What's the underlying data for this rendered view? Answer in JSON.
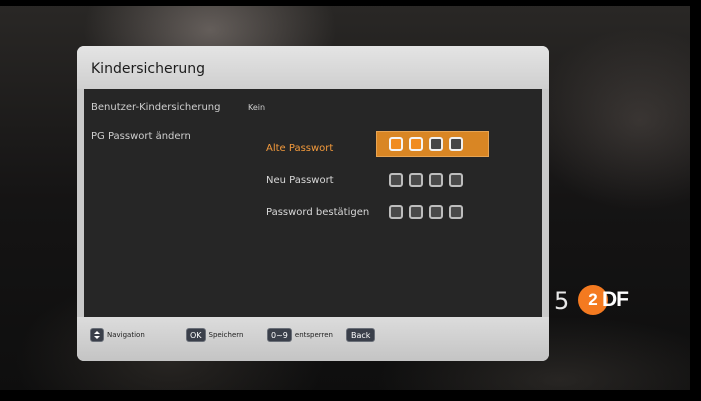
{
  "dialog": {
    "title": "Kindersicherung",
    "settings": [
      {
        "label": "Benutzer-Kindersicherung",
        "value": "Kein"
      },
      {
        "label": "PG Passwort ändern",
        "value": ""
      }
    ],
    "password_fields": [
      {
        "label": "Alte Passwort",
        "filled": 2,
        "total": 4,
        "active": true
      },
      {
        "label": "Neu Passwort",
        "filled": 0,
        "total": 4,
        "active": false
      },
      {
        "label": "Password bestätigen",
        "filled": 0,
        "total": 4,
        "active": false
      }
    ]
  },
  "footer": {
    "hints": [
      {
        "key": "",
        "icon": "updown-arrows-icon",
        "label": "Navigation"
      },
      {
        "key": "OK",
        "label": "Speichern"
      },
      {
        "key": "0~9",
        "label": "entsperren"
      },
      {
        "key": "Back",
        "label": ""
      }
    ]
  },
  "channel": {
    "number": "5",
    "logo": "ZDF"
  },
  "colors": {
    "accent": "#f08c20",
    "panel": "#262626",
    "frame": "#c9c9c9"
  }
}
